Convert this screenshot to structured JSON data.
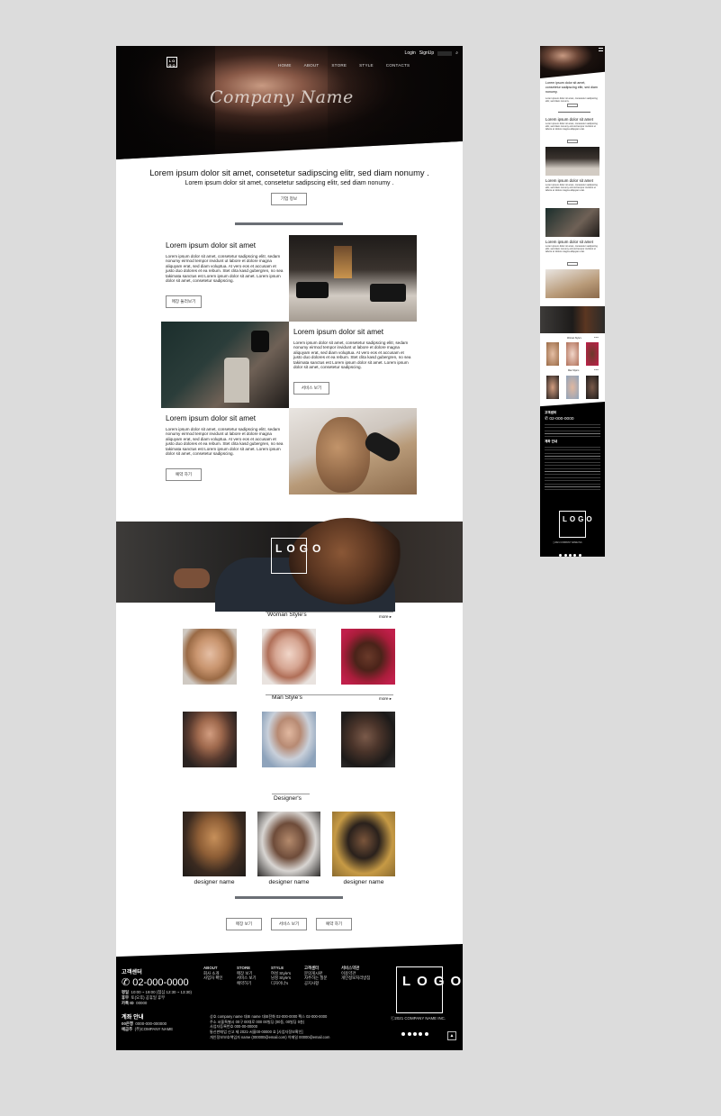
{
  "desktop": {
    "header": {
      "logo_text": "LOGO",
      "login": "Login",
      "signup": "SignUp",
      "nav": [
        "HOME",
        "ABOUT",
        "STORE",
        "STYLE",
        "CONTACTS"
      ],
      "brand_script": "Company Name"
    },
    "intro": {
      "headline": "Lorem ipsum dolor sit amet, consetetur sadipscing elitr, sed diam nonumy .",
      "subline": "Lorem ipsum dolor sit amet, consetetur sadipscing elitr, sed diam nonumy .",
      "button": "기업 정보"
    },
    "features": [
      {
        "title": "Lorem ipsum dolor sit amet",
        "body": "Lorem ipsum dolor sit amet, consetetur sadipscing elitr, sedam nonumy eirmod tempor invidunt ut labore et dolore magna aliquyam erat, sed diam voluptua. At vero eos et accusam et justo duo dolores et ea rebum. Stet clita kasd gubergren, no sea takimata sanctus est Lorem ipsum dolor sit amet. Lorem ipsum dolor sit amet, consetetur sadipscing.",
        "button": "매장 둘러보기"
      },
      {
        "title": "Lorem ipsum dolor sit amet",
        "body": "Lorem ipsum dolor sit amet, consetetur sadipscing elitr, sedam nonumy eirmod tempor invidunt ut labore et dolore magna aliquyam erat, sed diam voluptua. At vero eos et accusam et justo duo dolores et ea rebum. Stet clita kasd gubergren, no sea takimata sanctus est Lorem ipsum dolor sit amet. Lorem ipsum dolor sit amet, consetetur sadipscing.",
        "button": "서비스 보기"
      },
      {
        "title": "Lorem ipsum dolor sit amet",
        "body": "Lorem ipsum dolor sit amet, consetetur sadipscing elitr, sedam nonumy eirmod tempor invidunt ut labore et dolore magna aliquyam erat, sed diam voluptua. At vero eos et accusam et justo duo dolores et ea rebum. Stet clita kasd gubergren, no sea takimata sanctus est Lorem ipsum dolor sit amet. Lorem ipsum dolor sit amet, consetetur sadipscing.",
        "button": "예약 하기"
      }
    ],
    "band_logo": "LOGO",
    "woman_styles": {
      "title": "Woman Style's",
      "more": "more"
    },
    "man_styles": {
      "title": "Man  Style's",
      "more": "more"
    },
    "designers": {
      "title": "Designer's",
      "names": [
        "designer name",
        "designer name",
        "designer name"
      ]
    },
    "bottom_buttons": [
      "매장 보기",
      "서비스 보기",
      "예약 하기"
    ],
    "footer": {
      "cs_title": "고객센터",
      "phone": "02-000-0000",
      "hours_label": "평일",
      "hours": "10:00 ~ 19:00 (점심 12:30 ~ 13:30)",
      "holiday_label": "휴무",
      "holiday": "토(오후) 공휴일 휴무",
      "kakao_label": "카톡 ID",
      "kakao": "00000",
      "account_title": "계좌 안내",
      "bank_label": "00은행",
      "bank_no": "0000-000-000000",
      "holder_label": "예금주",
      "holder": "(주)COMPANY NAME",
      "columns": [
        {
          "title": "ABOUT",
          "items": [
            "회사 소개",
            "사업자 확인"
          ]
        },
        {
          "title": "STORE",
          "items": [
            "매장 보기",
            "서비스 보기",
            "예약하기"
          ]
        },
        {
          "title": "STYLE",
          "items": [
            "여성 Style's",
            "남성 Style's",
            "디자이너's"
          ]
        },
        {
          "title": "고객센터",
          "items": [
            "문의게시판",
            "자주하는 질문",
            "공지사항"
          ]
        },
        {
          "title": "서비스약관",
          "items": [
            "이용약관",
            "개인정보처리방침"
          ]
        }
      ],
      "info": [
        "상호  company name   대표  name   대표전화  02-000-0000   팩스  02-000-0000",
        "주소  서울특별시 00구 00대로 000 00빌딩 (00동, 00빌딩 0층)",
        "사업자등록번호  000-00-00000",
        "통신판매업 신고  제 2021-서울00-00000 호 [사업자정보확인]",
        "개인정보보호책임자  name (000000@email.com)   이메일  00000@email.com"
      ],
      "logo": "LOGO",
      "copyright": "ⓒ2021 COMPANY NAME INC.",
      "to_top": "▲"
    }
  },
  "mobile": {
    "headline": "Lorem ipsum dolor sit amet, consetetur sadipscing elitr, sed diam nonumy.",
    "sub": "Lorem ipsum dolor sit amet, consetetur sadipscing elitr, sed diam nonumy.",
    "feature_title": "Lorem ipsum dolor sit amet",
    "feature_body": "Lorem ipsum dolor sit amet, consetetur sadipscing elitr, sed diam nonumy eirmod tempor invidunt ut labore et dolore magna aliquyam erat.",
    "woman": "Woman Style's",
    "man": "Man Style's",
    "more": "more",
    "cs": "고객센터",
    "phone": "02-000-0000",
    "account": "계좌 안내",
    "logo": "LOGO",
    "copyright": "ⓒ2021 COMPANY NAME INC."
  }
}
